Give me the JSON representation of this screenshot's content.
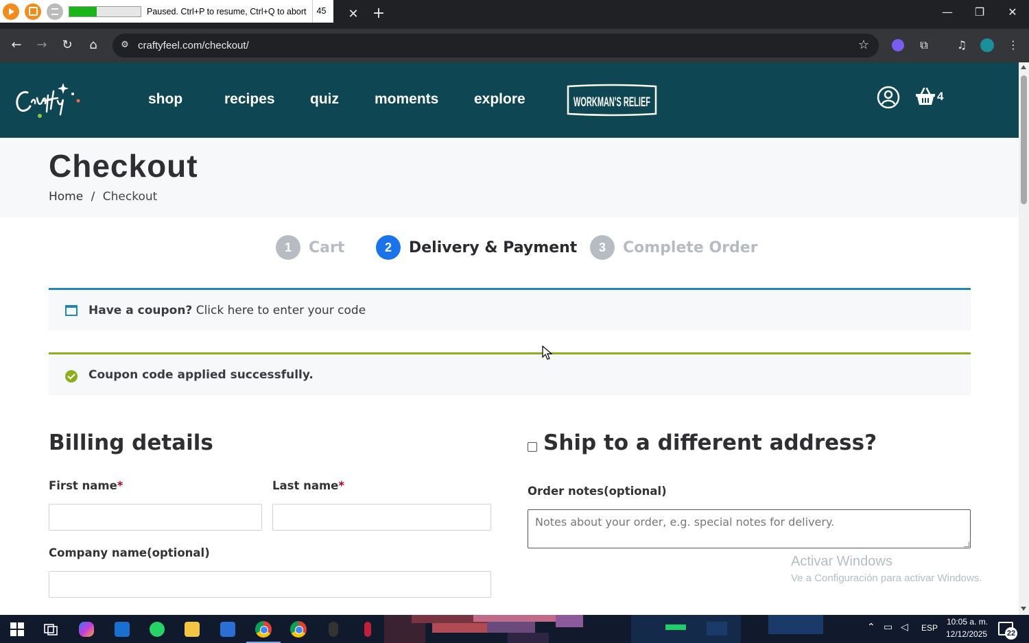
{
  "recorder": {
    "status": "Paused. Ctrl+P to resume, Ctrl+Q to abort",
    "count": "45",
    "progress_percent": 38
  },
  "browser": {
    "url": "craftyfeel.com/checkout/",
    "icons": {
      "back": "arrow-left-icon",
      "forward": "arrow-right-icon",
      "reload": "reload-icon",
      "home": "home-icon",
      "bookmark": "star-icon",
      "extensions": "puzzle-icon",
      "menu": "kebab-menu-icon"
    }
  },
  "site": {
    "nav": [
      {
        "label": "shop"
      },
      {
        "label": "recipes"
      },
      {
        "label": "quiz"
      },
      {
        "label": "moments"
      },
      {
        "label": "explore"
      }
    ],
    "cart_count": "4",
    "colors": {
      "header_bg": "#0e4753",
      "accent_blue": "#1a73e8",
      "notice_blue": "#1e85be",
      "success_green": "#8fae1b"
    }
  },
  "page": {
    "title": "Checkout",
    "breadcrumb": {
      "home": "Home",
      "separator": "/",
      "current": "Checkout"
    }
  },
  "steps": [
    {
      "number": "1",
      "label": "Cart",
      "state": "done"
    },
    {
      "number": "2",
      "label": "Delivery & Payment",
      "state": "active"
    },
    {
      "number": "3",
      "label": "Complete Order",
      "state": "pending"
    }
  ],
  "notices": {
    "coupon_question": "Have a coupon?",
    "coupon_link": "Click here to enter your code",
    "success": "Coupon code applied successfully."
  },
  "billing": {
    "title": "Billing details",
    "first_name_label": "First name",
    "last_name_label": "Last name",
    "required_mark": "*",
    "company_label": "Company name(optional)",
    "first_name_value": "",
    "last_name_value": "",
    "company_value": ""
  },
  "shipping": {
    "title": "Ship to a different address?",
    "checked": false,
    "notes_label": "Order notes(optional)",
    "notes_placeholder": "Notes about your order, e.g. special notes for delivery."
  },
  "watermark": {
    "title": "Activar Windows",
    "subtitle": "Ve a Configuración para activar Windows."
  },
  "taskbar": {
    "language": "ESP",
    "time": "10:05 a. m.",
    "date": "12/12/2025",
    "notifications": "22"
  }
}
